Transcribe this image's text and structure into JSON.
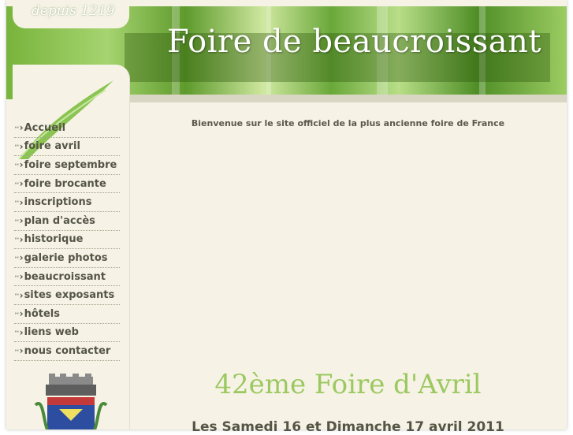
{
  "header": {
    "since_text": "depuis 1219",
    "site_title": "Foire de beaucroissant"
  },
  "sidebar": {
    "items": [
      {
        "label": "Accueil"
      },
      {
        "label": "foire avril"
      },
      {
        "label": "foire septembre"
      },
      {
        "label": "foire brocante"
      },
      {
        "label": "inscriptions"
      },
      {
        "label": "plan d'accès"
      },
      {
        "label": "historique"
      },
      {
        "label": "galerie photos"
      },
      {
        "label": "beaucroissant"
      },
      {
        "label": "sites exposants"
      },
      {
        "label": "hôtels"
      },
      {
        "label": "liens web"
      },
      {
        "label": "nous contacter"
      }
    ],
    "bullet_dots": "··",
    "bullet_arrow": "›"
  },
  "main": {
    "welcome": "Bienvenue sur le site officiel de la plus ancienne foire de France",
    "event_title": "42ème Foire d'Avril",
    "event_dates": "Les Samedi 16 et Dimanche 17 avril 2011"
  },
  "colors": {
    "background": "#f6f3e6",
    "accent_green": "#9cc860",
    "text": "#555545"
  }
}
